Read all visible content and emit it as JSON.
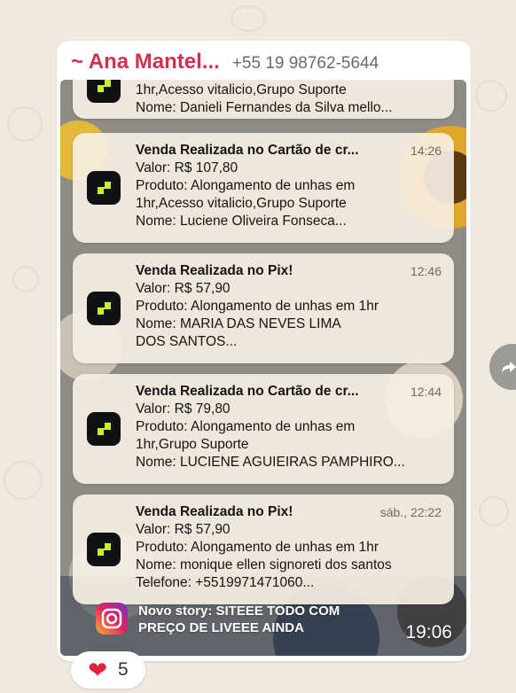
{
  "message": {
    "sender_name": "~ Ana Mantel...",
    "sender_phone": "+55 19 98762-5644",
    "time": "19:06"
  },
  "notifications": [
    {
      "title": "",
      "time": "",
      "lines": [
        "1hr,Acesso vitalicio,Grupo Suporte",
        "Nome: Danieli Fernandes da Silva mello..."
      ]
    },
    {
      "title": "Venda Realizada no Cartão de cr...",
      "time": "14:26",
      "lines": [
        "Valor: R$ 107,80",
        "Produto: Alongamento de unhas em",
        "1hr,Acesso vitalicio,Grupo Suporte",
        "Nome: Luciene Oliveira Fonseca..."
      ]
    },
    {
      "title": "Venda Realizada no Pix!",
      "time": "12:46",
      "lines": [
        "Valor: R$ 57,90",
        "Produto: Alongamento de unhas em 1hr",
        "Nome: MARIA DAS NEVES LIMA",
        "DOS SANTOS..."
      ]
    },
    {
      "title": "Venda Realizada no Cartão de cr...",
      "time": "12:44",
      "lines": [
        "Valor: R$ 79,80",
        "Produto: Alongamento de unhas em",
        "1hr,Grupo Suporte",
        "Nome: LUCIENE AGUIEIRAS PAMPHIRO..."
      ]
    },
    {
      "title": "Venda Realizada no Pix!",
      "time": "sáb., 22:22",
      "lines": [
        "Valor: R$ 57,90",
        "Produto: Alongamento de unhas em 1hr",
        "Nome: monique ellen signoreti dos santos",
        "Telefone: +5519971471060..."
      ]
    }
  ],
  "story": {
    "line1": "Novo story: SITEEE TODO COM",
    "line2": "PREÇO DE LIVEEE AINDA"
  },
  "reaction": {
    "emoji": "❤",
    "count": "5"
  },
  "colors": {
    "sender": "#d32f4f",
    "heart": "#e0243a",
    "app_icon_green": "#c6f02c"
  }
}
